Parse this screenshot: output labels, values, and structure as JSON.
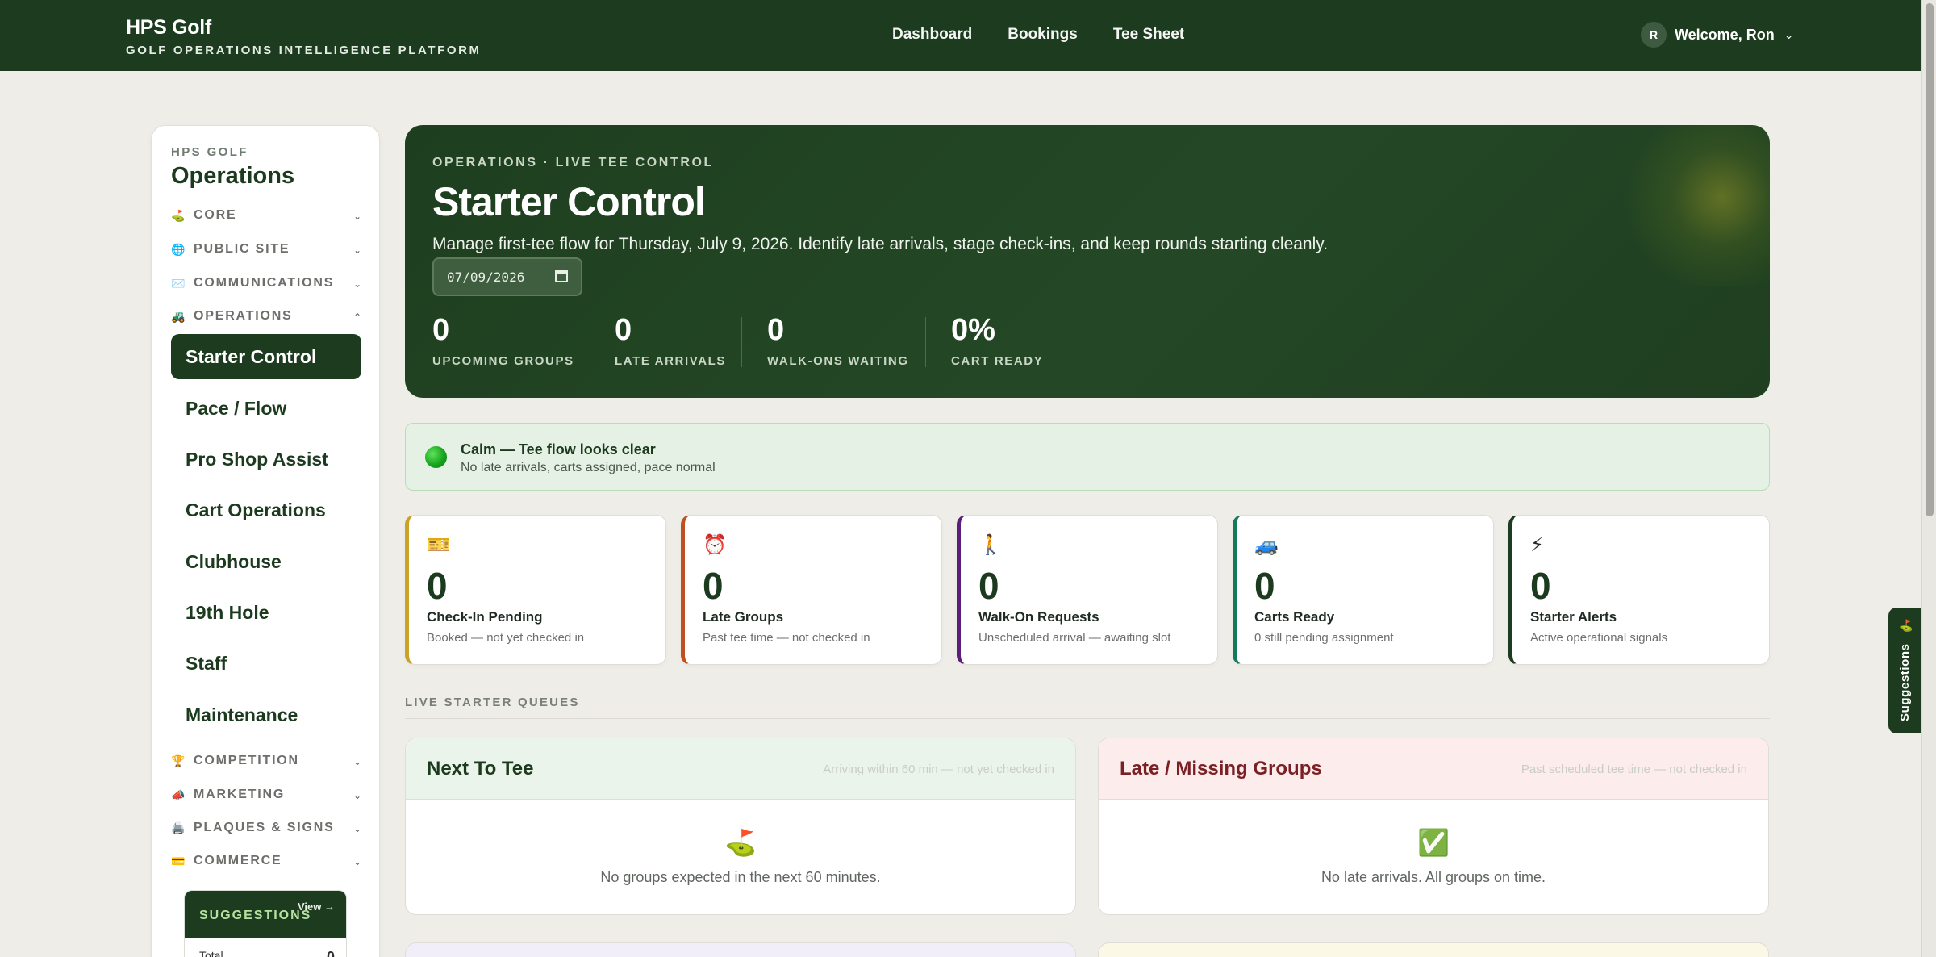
{
  "header": {
    "brand_name": "HPS Golf",
    "brand_subtitle": "GOLF OPERATIONS INTELLIGENCE PLATFORM",
    "nav": [
      "Dashboard",
      "Bookings",
      "Tee Sheet"
    ],
    "user_initial": "R",
    "welcome": "Welcome, Ron",
    "caret": "⌄"
  },
  "sidebar": {
    "kicker": "HPS GOLF",
    "title": "Operations",
    "groups_top": [
      {
        "icon": "⛳",
        "label": "CORE",
        "chevron": "⌄"
      },
      {
        "icon": "🌐",
        "label": "PUBLIC SITE",
        "chevron": "⌄"
      },
      {
        "icon": "✉️",
        "label": "COMMUNICATIONS",
        "chevron": "⌄"
      },
      {
        "icon": "🚜",
        "label": "OPERATIONS",
        "chevron": "⌃"
      }
    ],
    "items": [
      "Starter Control",
      "Pace / Flow",
      "Pro Shop Assist",
      "Cart Operations",
      "Clubhouse",
      "19th Hole",
      "Staff",
      "Maintenance"
    ],
    "groups_bottom": [
      {
        "icon": "🏆",
        "label": "COMPETITION",
        "chevron": "⌄"
      },
      {
        "icon": "📣",
        "label": "MARKETING",
        "chevron": "⌄"
      },
      {
        "icon": "🖨️",
        "label": "PLAQUES & SIGNS",
        "chevron": "⌄"
      },
      {
        "icon": "💳",
        "label": "COMMERCE",
        "chevron": "⌄"
      }
    ],
    "suggestions": {
      "title": "SUGGESTIONS",
      "view": "View →",
      "total_label": "Total",
      "total_value": "0"
    }
  },
  "hero": {
    "kicker": "OPERATIONS · LIVE TEE CONTROL",
    "title": "Starter Control",
    "description": "Manage first-tee flow for Thursday, July 9, 2026. Identify late arrivals, stage check-ins, and keep rounds starting cleanly.",
    "date_value": "07/09/2026",
    "stats": [
      {
        "value": "0",
        "label": "UPCOMING GROUPS"
      },
      {
        "value": "0",
        "label": "LATE ARRIVALS"
      },
      {
        "value": "0",
        "label": "WALK-ONS WAITING"
      },
      {
        "value": "0%",
        "label": "CART READY"
      }
    ]
  },
  "status": {
    "title": "Calm — Tee flow looks clear",
    "subtitle": "No late arrivals, carts assigned, pace normal"
  },
  "metrics": [
    {
      "icon": "🎫",
      "value": "0",
      "title": "Check-In Pending",
      "subtitle": "Booked — not yet checked in",
      "accent": "#c9a227"
    },
    {
      "icon": "⏰",
      "value": "0",
      "title": "Late Groups",
      "subtitle": "Past tee time — not checked in",
      "accent": "#c0501f"
    },
    {
      "icon": "🚶",
      "value": "0",
      "title": "Walk-On Requests",
      "subtitle": "Unscheduled arrival — awaiting slot",
      "accent": "#5b1e7a"
    },
    {
      "icon": "🚙",
      "value": "0",
      "title": "Carts Ready",
      "subtitle": "0 still pending assignment",
      "accent": "#137a5c"
    },
    {
      "icon": "⚡",
      "value": "0",
      "title": "Starter Alerts",
      "subtitle": "Active operational signals",
      "accent": "#1c3b1f"
    }
  ],
  "queues": {
    "section_label": "LIVE STARTER QUEUES",
    "next_to_tee": {
      "title": "Next To Tee",
      "note": "Arriving within 60 min — not yet checked in",
      "icon": "⛳",
      "empty_text": "No groups expected in the next 60 minutes."
    },
    "late_missing": {
      "title": "Late / Missing Groups",
      "note": "Past scheduled tee time — not checked in",
      "icon": "✅",
      "empty_text": "No late arrivals. All groups on time."
    }
  },
  "float_tab": {
    "icon": "⛳",
    "label": "Suggestions"
  },
  "colors": {
    "brand_dark_green": "#1c3b1f",
    "page_background": "#efede8",
    "status_green_bg": "#e4f1e4",
    "next_panel_header": "#ebf4ea",
    "late_panel_header": "#fcecec",
    "late_panel_title": "#7a1f24"
  }
}
